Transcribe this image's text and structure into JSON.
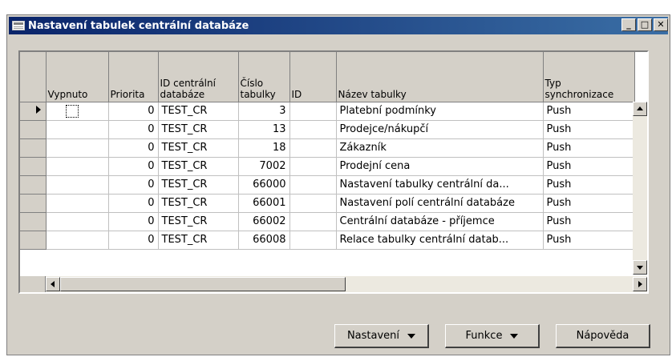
{
  "window": {
    "title": "Nastavení tabulek centrální databáze",
    "icon": "table-icon",
    "controls": [
      "minimize",
      "maximize",
      "close"
    ]
  },
  "table": {
    "columns": [
      {
        "key": "vypnuto",
        "label": "Vypnuto"
      },
      {
        "key": "priorita",
        "label": "Priorita"
      },
      {
        "key": "id_central",
        "label": "ID centrální databáze"
      },
      {
        "key": "cislo",
        "label": "Číslo tabulky"
      },
      {
        "key": "id",
        "label": "ID"
      },
      {
        "key": "nazev",
        "label": "Název tabulky"
      },
      {
        "key": "typ",
        "label": "Typ synchronizace"
      }
    ],
    "rows": [
      {
        "vypnuto": "",
        "priorita": "0",
        "id_central": "TEST_CR",
        "cislo": "3",
        "id": "",
        "nazev": "Platební podmínky",
        "typ": "Push"
      },
      {
        "vypnuto": "",
        "priorita": "0",
        "id_central": "TEST_CR",
        "cislo": "13",
        "id": "",
        "nazev": "Prodejce/nákupčí",
        "typ": "Push"
      },
      {
        "vypnuto": "",
        "priorita": "0",
        "id_central": "TEST_CR",
        "cislo": "18",
        "id": "",
        "nazev": "Zákazník",
        "typ": "Push"
      },
      {
        "vypnuto": "",
        "priorita": "0",
        "id_central": "TEST_CR",
        "cislo": "7002",
        "id": "",
        "nazev": "Prodejní cena",
        "typ": "Push"
      },
      {
        "vypnuto": "",
        "priorita": "0",
        "id_central": "TEST_CR",
        "cislo": "66000",
        "id": "",
        "nazev": "Nastavení tabulky centrální da...",
        "typ": "Push"
      },
      {
        "vypnuto": "",
        "priorita": "0",
        "id_central": "TEST_CR",
        "cislo": "66001",
        "id": "",
        "nazev": "Nastavení polí centrální databáze",
        "typ": "Push"
      },
      {
        "vypnuto": "",
        "priorita": "0",
        "id_central": "TEST_CR",
        "cislo": "66002",
        "id": "",
        "nazev": "Centrální databáze - příjemce",
        "typ": "Push"
      },
      {
        "vypnuto": "",
        "priorita": "0",
        "id_central": "TEST_CR",
        "cislo": "66008",
        "id": "",
        "nazev": "Relace tabulky centrální datab...",
        "typ": "Push"
      }
    ],
    "current_row": 0
  },
  "buttons": {
    "nastaveni": "Nastavení",
    "funkce": "Funkce",
    "napoveda": "Nápověda"
  },
  "colors": {
    "titlebar_start": "#0a246a",
    "titlebar_end": "#3a6ea5",
    "face": "#d4d0c8"
  }
}
